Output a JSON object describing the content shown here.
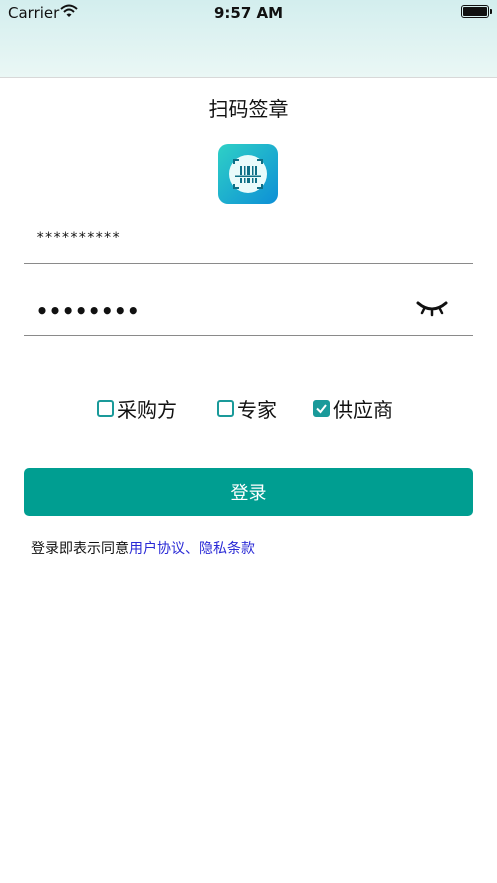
{
  "status_bar": {
    "carrier": "Carrier",
    "time": "9:57 AM",
    "battery": "full"
  },
  "page": {
    "title": "扫码签章",
    "logo_icon": "barcode-scan-icon"
  },
  "form": {
    "account_value": "**********",
    "password_value": "••••••••",
    "eye_icon": "eye-closed-icon"
  },
  "roles": [
    {
      "label": "采购方",
      "checked": false
    },
    {
      "label": "专家",
      "checked": false
    },
    {
      "label": "供应商",
      "checked": true
    }
  ],
  "login_button": "登录",
  "agreement": {
    "prefix": "登录即表示同意",
    "user_agreement": "用户协议",
    "separator": "、",
    "privacy": "隐私条款"
  },
  "colors": {
    "accent": "#009e91",
    "link": "#2a2ad6",
    "checkbox": "#1a9a9a"
  }
}
